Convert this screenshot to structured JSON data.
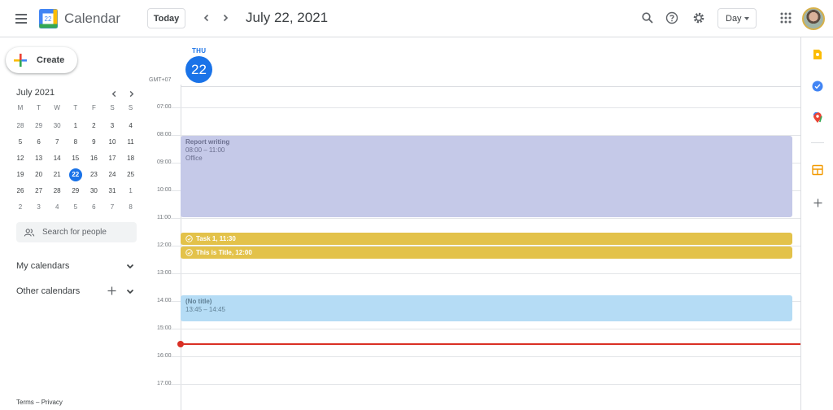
{
  "header": {
    "app_title": "Calendar",
    "logo_number": "22",
    "today_label": "Today",
    "date_title": "July 22, 2021",
    "view_label": "Day"
  },
  "sidebar": {
    "create_label": "Create",
    "mini_calendar": {
      "month_title": "July 2021",
      "weekdays": [
        "M",
        "T",
        "W",
        "T",
        "F",
        "S",
        "S"
      ],
      "weeks": [
        [
          "28",
          "29",
          "30",
          "1",
          "2",
          "3",
          "4"
        ],
        [
          "5",
          "6",
          "7",
          "8",
          "9",
          "10",
          "11"
        ],
        [
          "12",
          "13",
          "14",
          "15",
          "16",
          "17",
          "18"
        ],
        [
          "19",
          "20",
          "21",
          "22",
          "23",
          "24",
          "25"
        ],
        [
          "26",
          "27",
          "28",
          "29",
          "30",
          "31",
          "1"
        ],
        [
          "2",
          "3",
          "4",
          "5",
          "6",
          "7",
          "8"
        ]
      ],
      "selected": "22"
    },
    "search_people_placeholder": "Search for people",
    "my_calendars_label": "My calendars",
    "other_calendars_label": "Other calendars",
    "terms_label": "Terms",
    "separator": "–",
    "privacy_label": "Privacy"
  },
  "day_view": {
    "weekday": "THU",
    "day_number": "22",
    "timezone": "GMT+07",
    "hour_labels": [
      "07:00",
      "08:00",
      "09:00",
      "10:00",
      "11:00",
      "12:00",
      "13:00",
      "14:00",
      "15:00",
      "16:00",
      "17:00"
    ],
    "events": [
      {
        "title": "Report writing",
        "time": "08:00 – 11:00",
        "location": "Office",
        "color": "#c5c9e8"
      },
      {
        "title": "Task 1, 11:30",
        "color": "#e3c24a"
      },
      {
        "title": "This is Title, 12:00",
        "color": "#e3c24a"
      },
      {
        "title": "(No title)",
        "time": "13:45 – 14:45",
        "color": "#b5dcf5"
      }
    ]
  },
  "colors": {
    "accent": "#1a73e8",
    "now_line": "#d93025"
  }
}
